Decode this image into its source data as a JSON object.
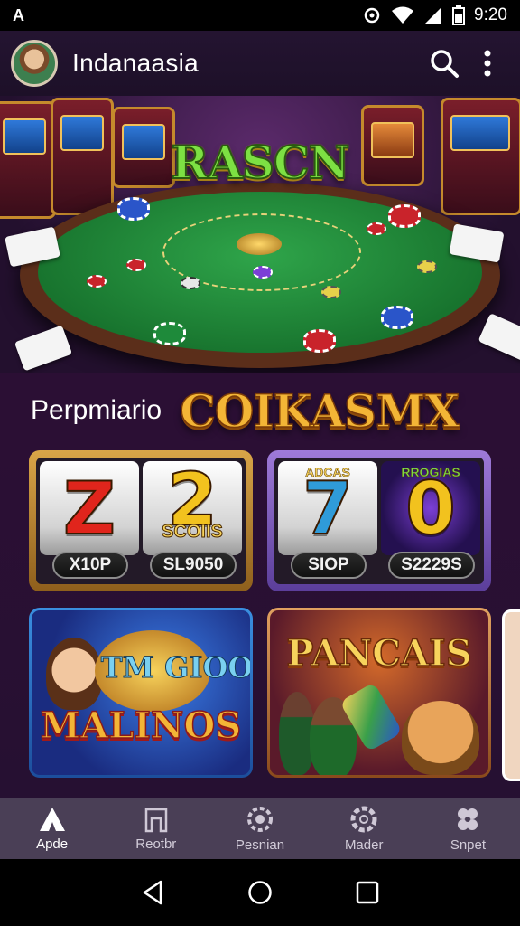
{
  "status_bar": {
    "left_glyph": "A",
    "time": "9:20",
    "icons": [
      "sync-icon",
      "wifi-icon",
      "signal-icon",
      "battery-icon"
    ]
  },
  "app_bar": {
    "title": "Indanaasia",
    "icons": [
      "search-icon",
      "more-vert-icon"
    ]
  },
  "hero": {
    "logo_text": "RASCN"
  },
  "section": {
    "label": "Perpmiario",
    "brand": "COIKASMX"
  },
  "games": [
    {
      "tag_left": "",
      "symbol_left": "Z",
      "symbol_right": "2",
      "sub_right": "SCOIIS",
      "label_left": "X10P",
      "label_right": "SL9050"
    },
    {
      "tag_left": "ADCAS",
      "tag_right": "RROGIAS",
      "symbol_left": "7",
      "symbol_right": "0",
      "label_left": "SIOP",
      "label_right": "S2229S"
    },
    {
      "title_top": "TM GIOO",
      "title_bottom": "MALINOS"
    },
    {
      "title": "PANCAIS"
    }
  ],
  "bottom_nav": [
    {
      "label": "Apde",
      "icon": "home-icon",
      "active": true
    },
    {
      "label": "Reotbr",
      "icon": "store-icon",
      "active": false
    },
    {
      "label": "Pesnian",
      "icon": "settings-icon",
      "active": false
    },
    {
      "label": "Mader",
      "icon": "gear-icon",
      "active": false
    },
    {
      "label": "Snpet",
      "icon": "flower-icon",
      "active": false
    }
  ],
  "colors": {
    "background": "#2b0f34",
    "app_bar": "#1d1028",
    "bottom_nav": "#4a3f56",
    "accent_gold": "#f3b536",
    "felt_green": "#17722d"
  }
}
